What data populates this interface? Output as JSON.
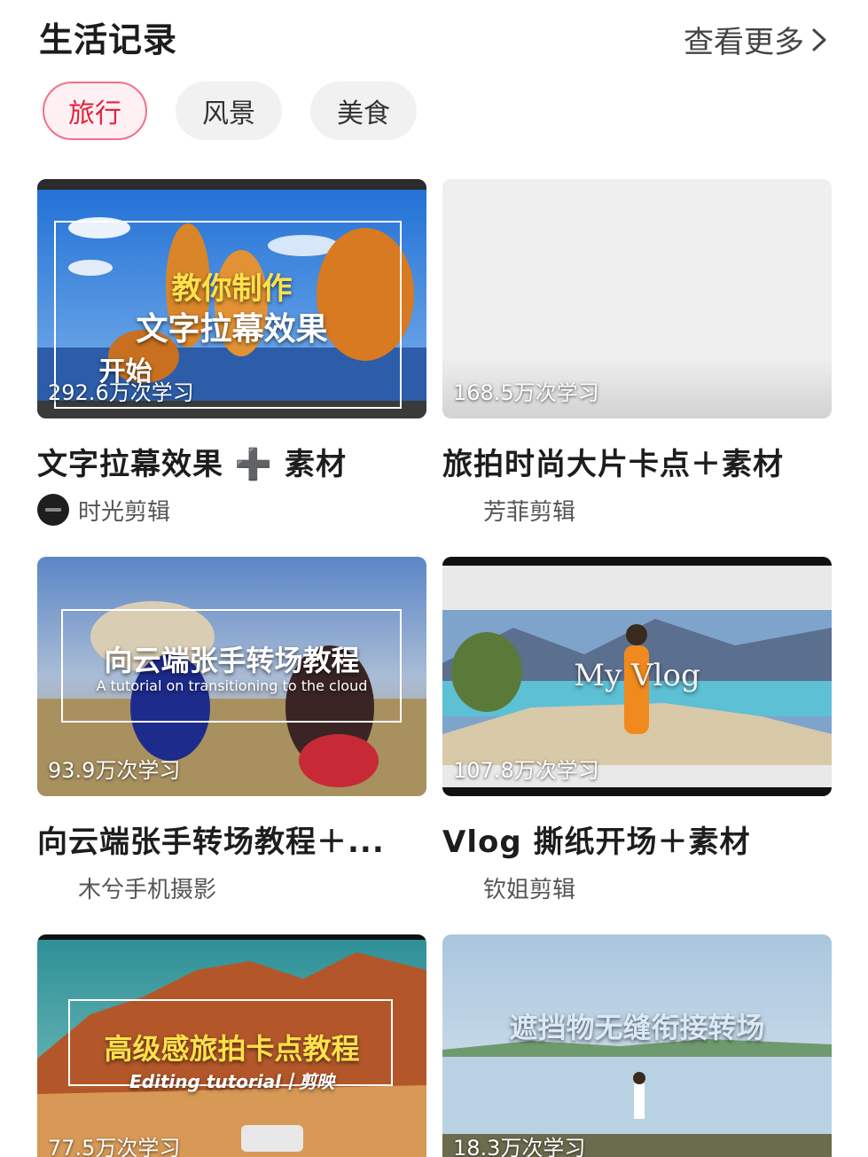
{
  "header": {
    "title": "生活记录",
    "more_label": "查看更多"
  },
  "chips": [
    {
      "label": "旅行",
      "active": true
    },
    {
      "label": "风景",
      "active": false
    },
    {
      "label": "美食",
      "active": false
    }
  ],
  "cards": [
    {
      "title": "文字拉幕效果 ➕ 素材",
      "views": "292.6万次学习",
      "author": "时光剪辑",
      "overlay_lines": [
        "教你制作",
        "文字拉幕效果",
        "开始"
      ],
      "has_avatar": true
    },
    {
      "title": "旅拍时尚大片卡点＋素材",
      "views": "168.5万次学习",
      "author": "芳菲剪辑",
      "overlay_lines": [],
      "has_avatar": false
    },
    {
      "title": "向云端张手转场教程＋...",
      "views": "93.9万次学习",
      "author": "木兮手机摄影",
      "overlay_lines": [
        "向云端张手转场教程",
        "A tutorial on transitioning to the cloud"
      ],
      "has_avatar": false
    },
    {
      "title": "Vlog 撕纸开场＋素材",
      "views": "107.8万次学习",
      "author": "钦姐剪辑",
      "overlay_lines": [
        "My Vlog"
      ],
      "has_avatar": false
    },
    {
      "title": "",
      "views": "77.5万次学习",
      "author": "",
      "overlay_lines": [
        "高级感旅拍卡点教程",
        "Editing tutorial丨剪映"
      ],
      "has_avatar": false
    },
    {
      "title": "",
      "views": "18.3万次学习",
      "author": "",
      "overlay_lines": [
        "遮挡物无缝衔接转场"
      ],
      "has_avatar": false
    }
  ],
  "colors": {
    "accent": "#e2233f",
    "chip_bg": "#f1f1f1"
  }
}
